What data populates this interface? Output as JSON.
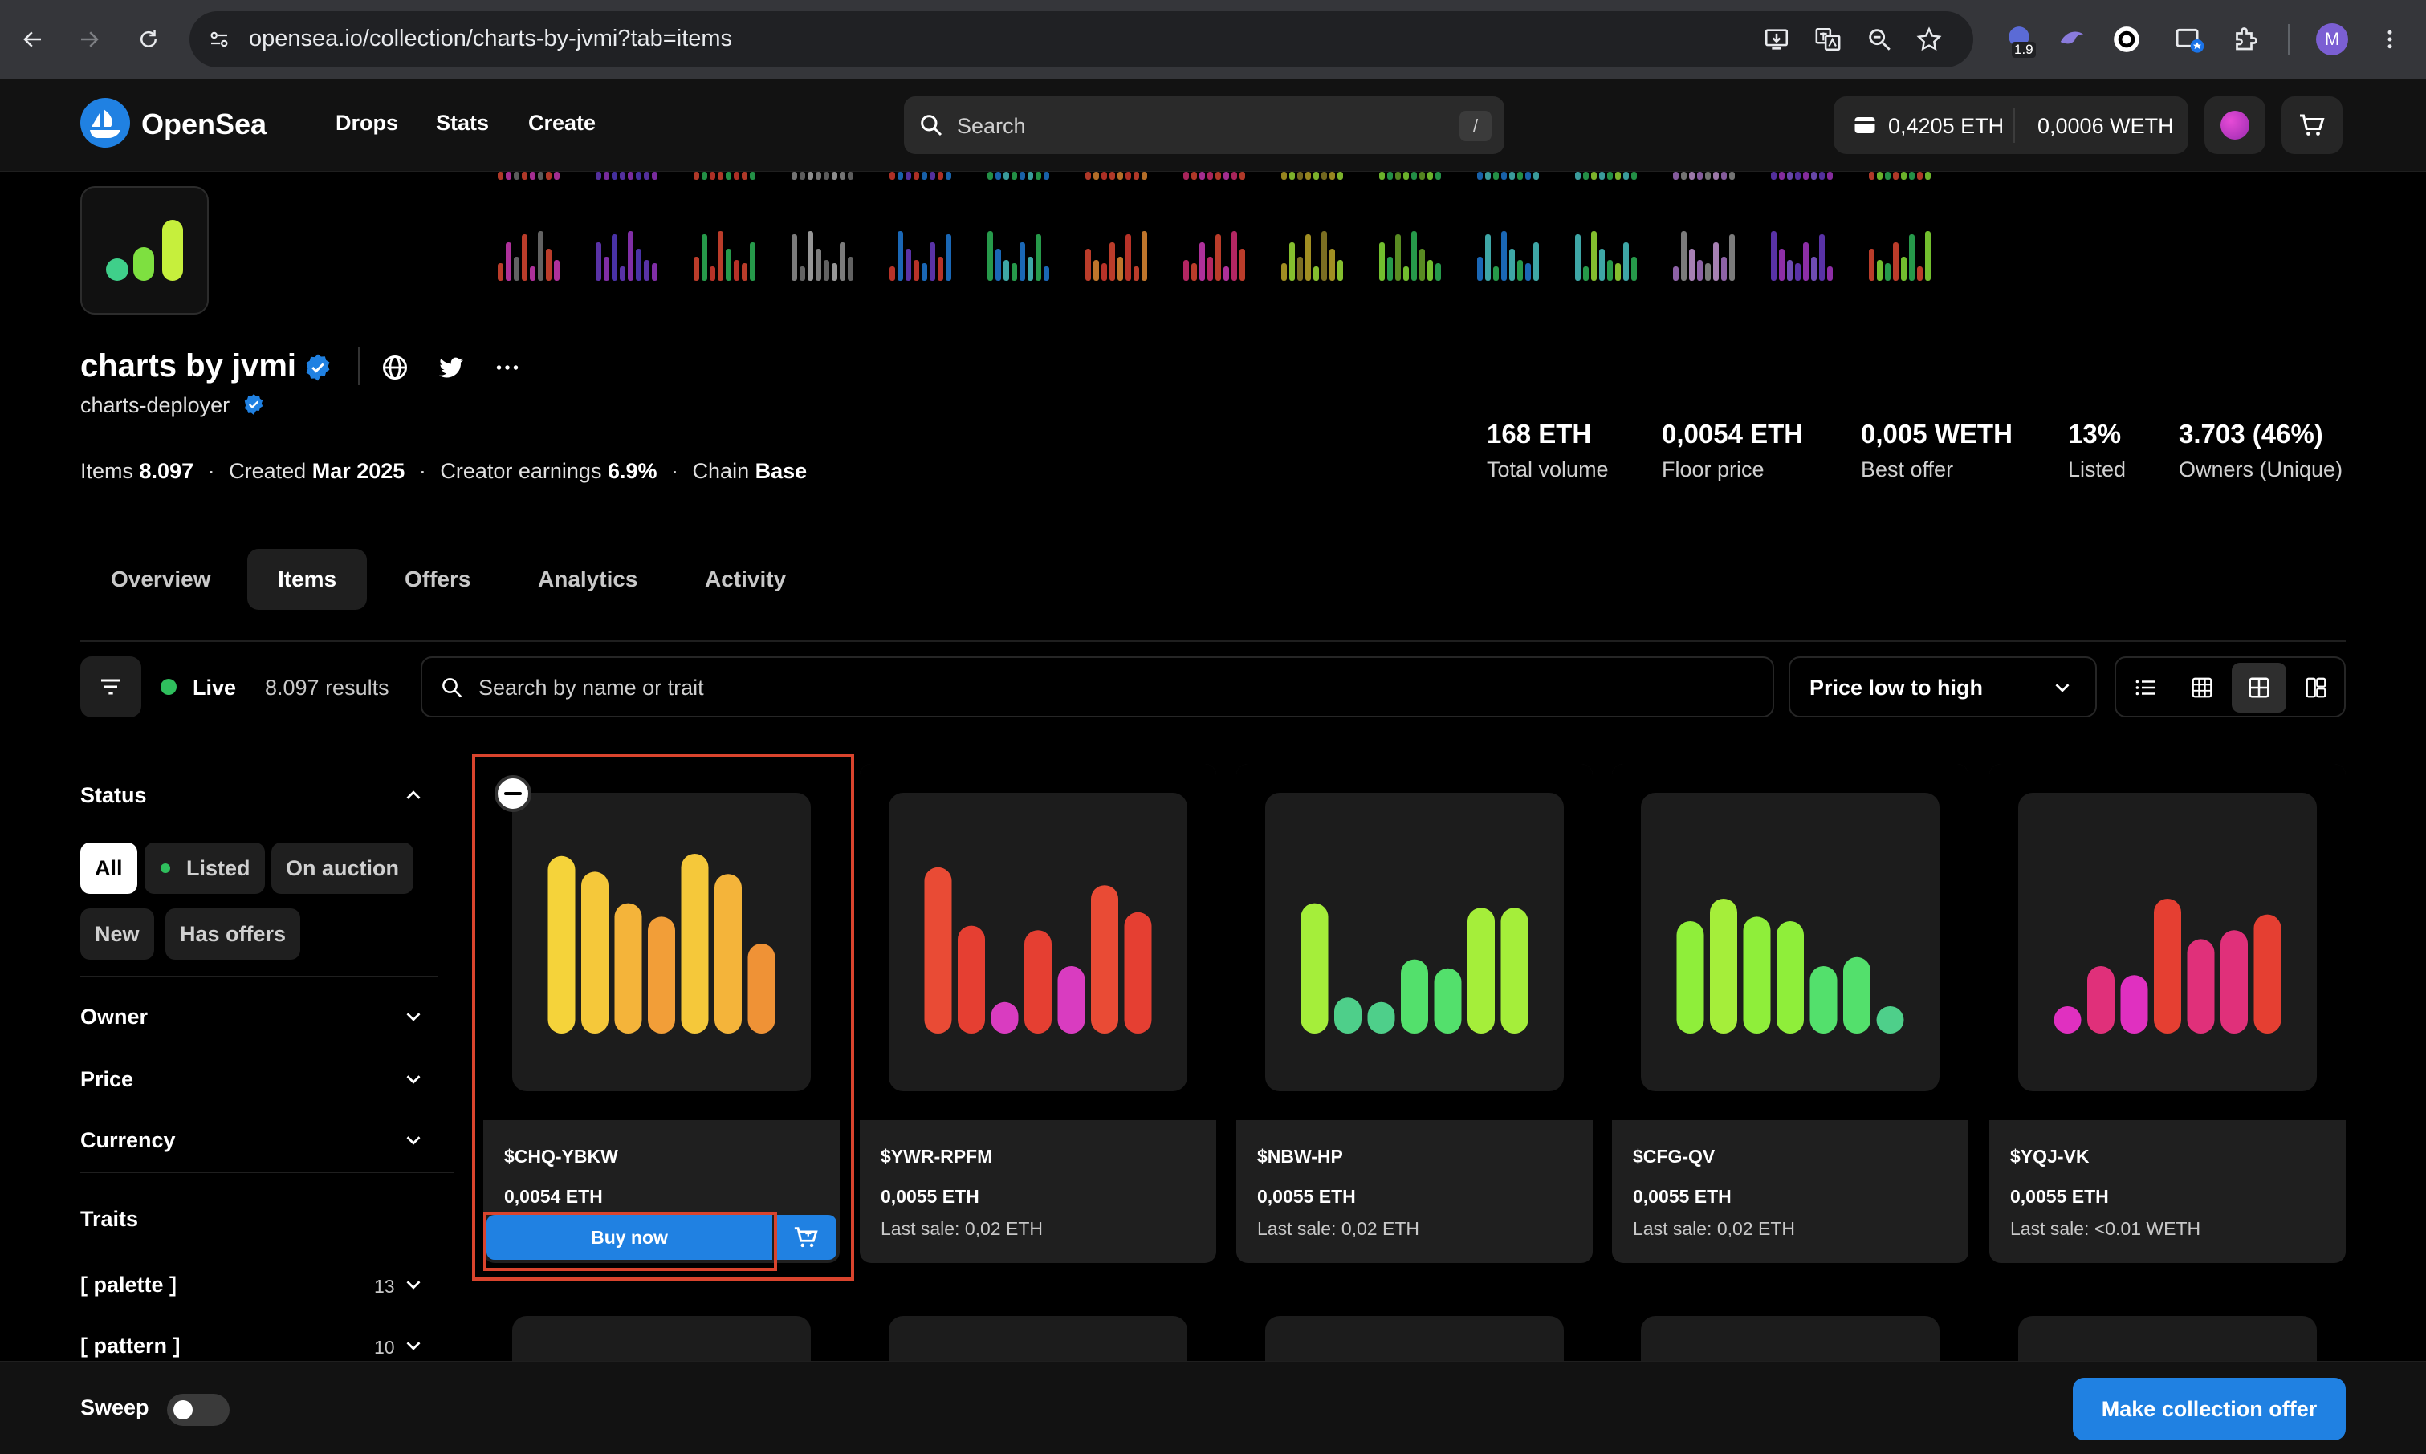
{
  "browser": {
    "url": "opensea.io/collection/charts-by-jvmi?tab=items",
    "ext_badge": "1.9",
    "profile_initial": "M"
  },
  "nav": {
    "brand": "OpenSea",
    "links": [
      "Drops",
      "Stats",
      "Create"
    ],
    "search_placeholder": "Search",
    "search_shortcut": "/",
    "eth_balance": "0,4205 ETH",
    "weth_balance": "0,0006 WETH"
  },
  "collection": {
    "name": "charts by jvmi",
    "deployer": "charts-deployer",
    "meta": {
      "items_label": "Items",
      "items_value": "8.097",
      "created_label": "Created",
      "created_value": "Mar 2025",
      "earnings_label": "Creator earnings",
      "earnings_value": "6.9%",
      "chain_label": "Chain",
      "chain_value": "Base"
    },
    "stats": [
      {
        "value": "168 ETH",
        "label": "Total volume"
      },
      {
        "value": "0,0054 ETH",
        "label": "Floor price"
      },
      {
        "value": "0,005 WETH",
        "label": "Best offer"
      },
      {
        "value": "13%",
        "label": "Listed"
      },
      {
        "value": "3.703 (46%)",
        "label": "Owners (Unique)"
      }
    ]
  },
  "tabs": [
    "Overview",
    "Items",
    "Offers",
    "Analytics",
    "Activity"
  ],
  "toolbar": {
    "live": "Live",
    "results": "8.097 results",
    "search_placeholder": "Search by name or trait",
    "sort": "Price low to high"
  },
  "sidebar": {
    "status_title": "Status",
    "status_options": [
      "All",
      "Listed",
      "On auction",
      "New",
      "Has offers"
    ],
    "filters": [
      "Owner",
      "Price",
      "Currency"
    ],
    "traits_title": "Traits",
    "traits": [
      {
        "name": "[ palette ]",
        "count": "13"
      },
      {
        "name": "[ pattern ]",
        "count": "10"
      }
    ],
    "sweep": "Sweep"
  },
  "cards": [
    {
      "name": "$CHQ-YBKW",
      "price": "0,0054 ETH",
      "last_sale": "",
      "buy": "Buy now",
      "bars": [
        0.79,
        0.72,
        0.58,
        0.52,
        0.8,
        0.71,
        0.4
      ],
      "colors": [
        "#f5d33a",
        "#f5c83a",
        "#f4b43a",
        "#f29e38",
        "#f5c83a",
        "#f4b43a",
        "#ef9236"
      ]
    },
    {
      "name": "$YWR-RPFM",
      "price": "0,0055 ETH",
      "last_sale": "Last sale: 0,02 ETH",
      "bars": [
        0.74,
        0.48,
        0.14,
        0.46,
        0.3,
        0.66,
        0.54
      ],
      "colors": [
        "#e94b35",
        "#e53f32",
        "#d93cc0",
        "#e53f32",
        "#d93cc0",
        "#e94b35",
        "#e53f32"
      ]
    },
    {
      "name": "$NBW-HP",
      "price": "0,0055 ETH",
      "last_sale": "Last sale: 0,02 ETH",
      "bars": [
        0.58,
        0.16,
        0.14,
        0.33,
        0.29,
        0.56,
        0.56
      ],
      "colors": [
        "#a5ee3a",
        "#4ecf8a",
        "#4ecf8a",
        "#53e06c",
        "#53e06c",
        "#a5ee3a",
        "#a5ee3a"
      ]
    },
    {
      "name": "$CFG-QV",
      "price": "0,0055 ETH",
      "last_sale": "Last sale: 0,02 ETH",
      "bars": [
        0.5,
        0.6,
        0.52,
        0.5,
        0.3,
        0.34,
        0.12
      ],
      "colors": [
        "#8fee3a",
        "#a5ee3a",
        "#8fee3a",
        "#8fee3a",
        "#53e06c",
        "#53e06c",
        "#4ecf8a"
      ]
    },
    {
      "name": "$YQJ-VK",
      "price": "0,0055 ETH",
      "last_sale": "Last sale: <0.01 WETH",
      "bars": [
        0.11,
        0.3,
        0.26,
        0.6,
        0.42,
        0.46,
        0.53
      ],
      "colors": [
        "#e030c0",
        "#e0307a",
        "#e030c0",
        "#e53f32",
        "#e0307a",
        "#e0307a",
        "#e53f32"
      ]
    }
  ],
  "footer": {
    "offer_button": "Make collection offer"
  },
  "colors": {
    "accent": "#2081e2",
    "live": "#2fbf5d",
    "highlight": "#d9442d"
  }
}
